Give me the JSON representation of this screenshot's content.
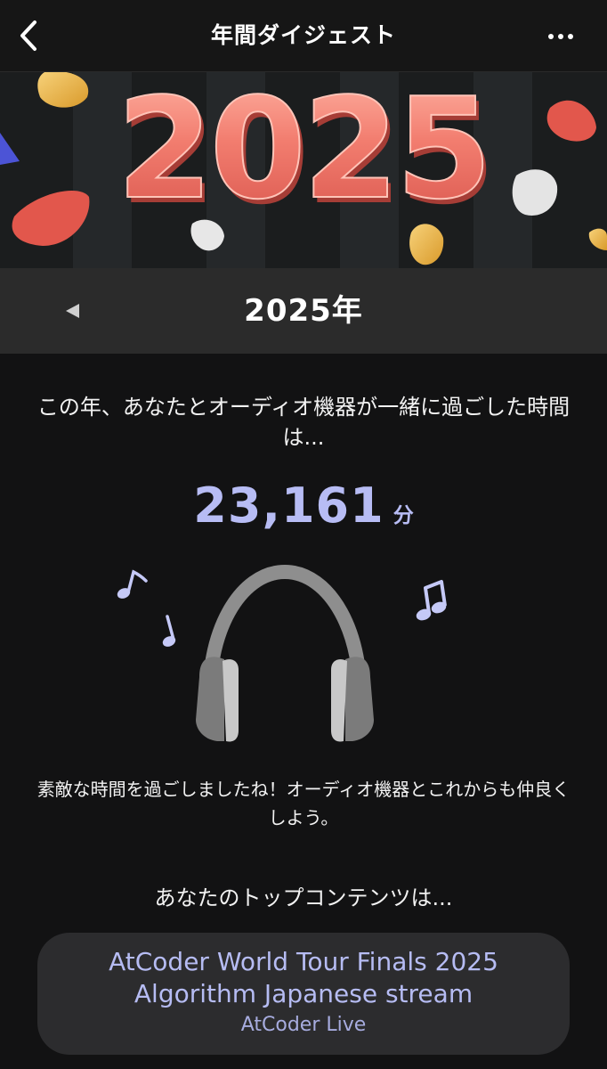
{
  "header": {
    "title": "年間ダイジェスト",
    "back_icon": "chevron-left-icon",
    "more_icon": "more-horizontal-icon"
  },
  "banner": {
    "text": "2025"
  },
  "year_selector": {
    "label": "2025年",
    "prev_icon": "triangle-left-icon"
  },
  "summary": {
    "intro": "この年、あなたとオーディオ機器が一緒に過ごした時間は...",
    "minutes_value": "23,161",
    "minutes_unit": "分",
    "illustration_icon": "headphones-icon",
    "outro": "素敵な時間を過ごしましたね！オーディオ機器とこれからも仲良くしよう。"
  },
  "top_content": {
    "label": "あなたのトップコンテンツは...",
    "title_line1": "AtCoder World Tour Finals 2025",
    "title_line2": "Algorithm Japanese stream",
    "channel": "AtCoder Live"
  },
  "colors": {
    "accent": "#b7bcf4",
    "background": "#121213",
    "card": "#2c2c2e",
    "balloon": "#f07a6d"
  }
}
